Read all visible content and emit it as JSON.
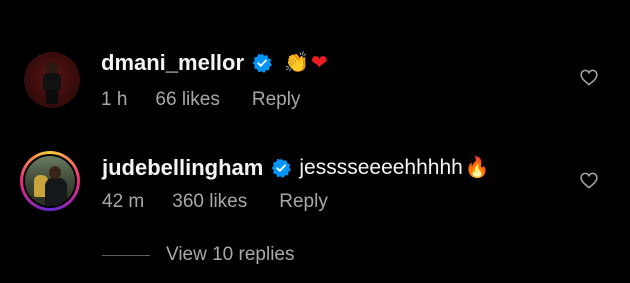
{
  "comments": [
    {
      "username": "dmani_mellor",
      "verified": true,
      "text": "",
      "emojis": [
        "👏",
        "❤"
      ],
      "time": "1 h",
      "likes": "66 likes",
      "reply_label": "Reply",
      "avatar_icon": "avatar-photo",
      "like_icon": "heart-outline-icon"
    },
    {
      "username": "judebellingham",
      "verified": true,
      "text": "jesssseeeehhhhh",
      "emojis": [
        "🔥"
      ],
      "time": "42 m",
      "likes": "360 likes",
      "reply_label": "Reply",
      "avatar_icon": "avatar-photo",
      "story_ring": true,
      "like_icon": "heart-outline-icon"
    }
  ],
  "view_replies_label": "View 10 replies",
  "colors": {
    "background": "#000000",
    "primary_text": "#f5f5f5",
    "secondary_text": "#a8a8a8",
    "verified_blue": "#0095f6",
    "heart_red": "#ed1c24"
  }
}
